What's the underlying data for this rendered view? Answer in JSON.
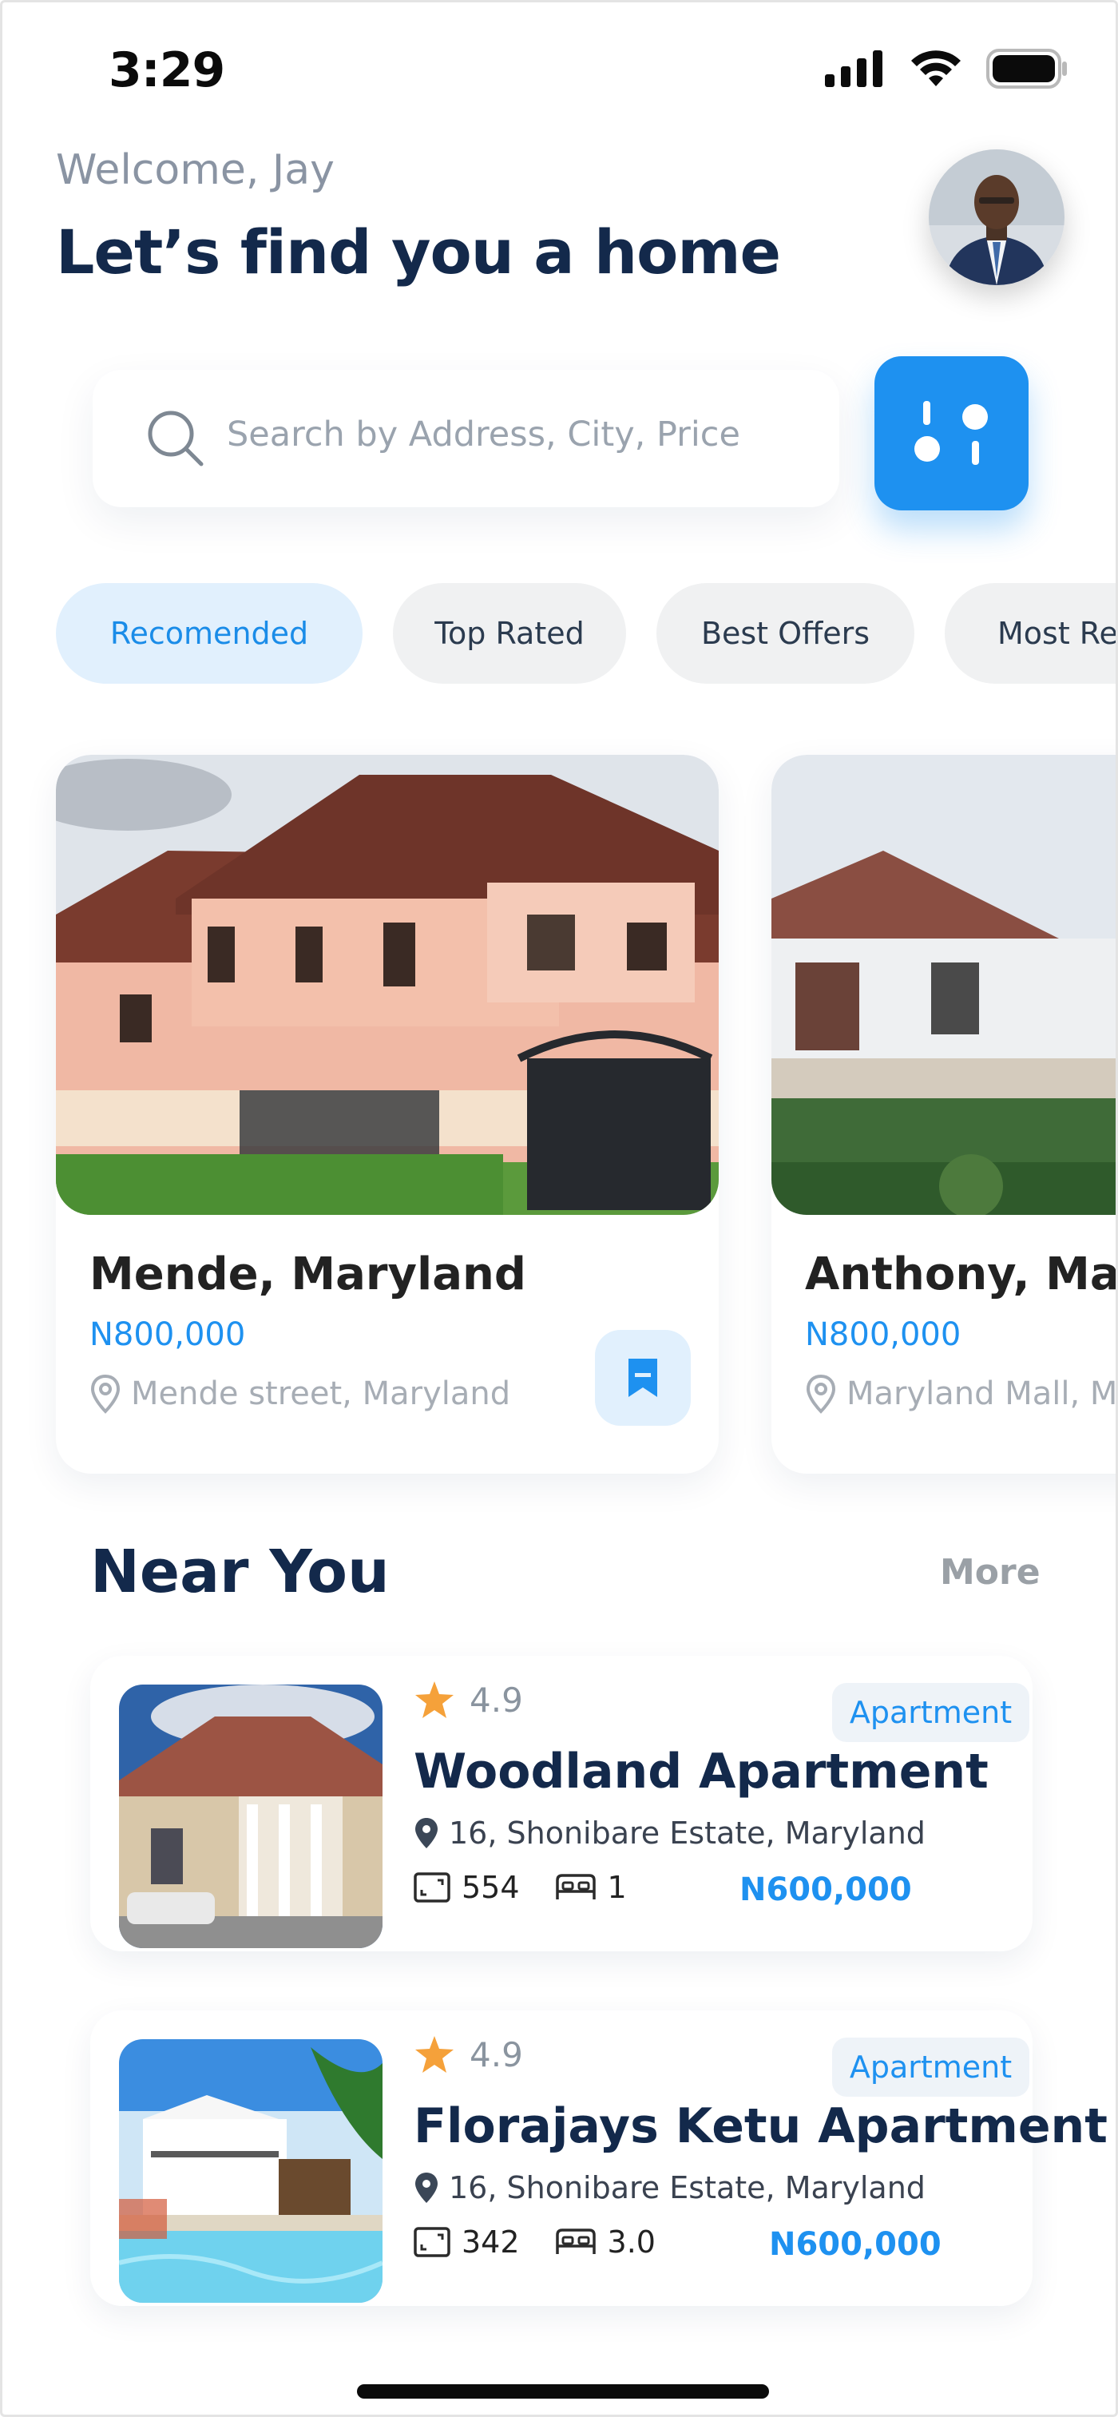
{
  "status_bar": {
    "time": "3:29"
  },
  "header": {
    "welcome": "Welcome, Jay",
    "headline": "Let’s find you a home"
  },
  "search": {
    "placeholder": "Search by Address, City, Price"
  },
  "filters": [
    {
      "label": "Recomended",
      "active": true
    },
    {
      "label": "Top Rated",
      "active": false
    },
    {
      "label": "Best Offers",
      "active": false
    },
    {
      "label": "Most Re",
      "active": false
    }
  ],
  "featured": [
    {
      "title": "Mende, Maryland",
      "price": "N800,000",
      "location": "Mende street, Maryland"
    },
    {
      "title": "Anthony, Mary",
      "price": "N800,000",
      "location": "Maryland Mall, M"
    }
  ],
  "near_you": {
    "title": "Near You",
    "more": "More",
    "listings": [
      {
        "rating": "4.9",
        "type": "Apartment",
        "title": "Woodland Apartment",
        "address": "16, Shonibare Estate, Maryland",
        "area": "554",
        "beds": "1",
        "price": "N600,000"
      },
      {
        "rating": "4.9",
        "type": "Apartment",
        "title": "Florajays Ketu Apartment",
        "address": "16, Shonibare Estate, Maryland",
        "area": "342",
        "beds": "3.0",
        "price": "N600,000"
      }
    ]
  },
  "colors": {
    "accent": "#1e91f0",
    "heading": "#13294b",
    "star": "#f5a13a",
    "muted": "#8a94a3"
  }
}
